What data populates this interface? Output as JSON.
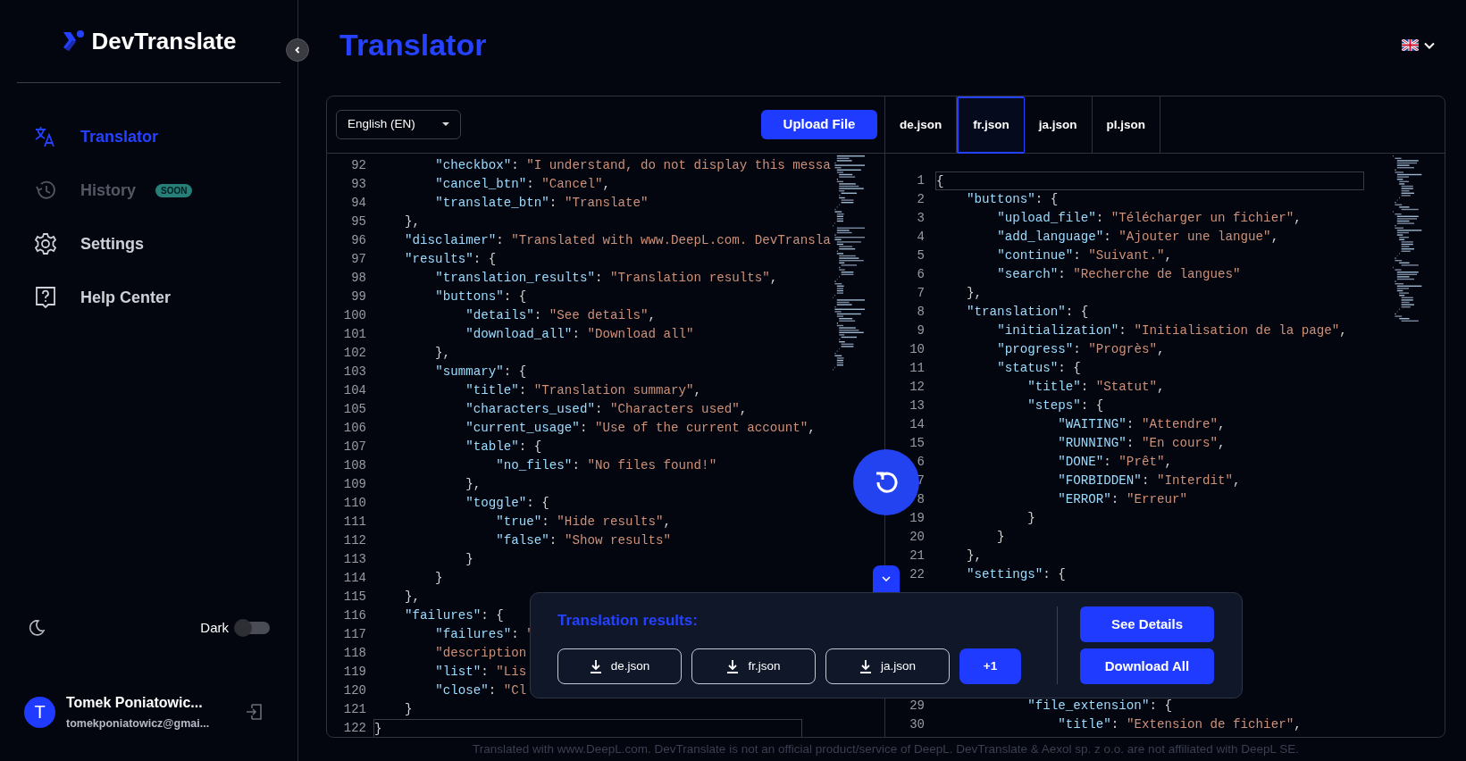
{
  "sidebar": {
    "brand": "DevTranslate",
    "nav": [
      {
        "label": "Translator",
        "selected": true,
        "disabled": false
      },
      {
        "label": "History",
        "selected": false,
        "disabled": true,
        "badge": "SOON"
      },
      {
        "label": "Settings",
        "selected": false,
        "disabled": false
      },
      {
        "label": "Help Center",
        "selected": false,
        "disabled": false
      }
    ],
    "theme": {
      "label": "Dark",
      "on": false
    },
    "user": {
      "initial": "T",
      "name": "Tomek Poniatowic...",
      "email": "tomekponiatowicz@gmai..."
    }
  },
  "page_title": "Translator",
  "source": {
    "language": "English (EN)",
    "upload_button": "Upload File",
    "lines": [
      {
        "kind": "code",
        "n": "92",
        "text": "        \"checkbox\": \"I understand, do not display this messa",
        "current": false
      },
      {
        "kind": "code",
        "n": "93",
        "text": "        \"cancel_btn\": \"Cancel\",",
        "current": false
      },
      {
        "kind": "code",
        "n": "94",
        "text": "        \"translate_btn\": \"Translate\"",
        "current": false
      },
      {
        "kind": "code",
        "n": "95",
        "text": "    },",
        "current": false
      },
      {
        "kind": "code",
        "n": "96",
        "text": "    \"disclaimer\": \"Translated with www.DeepL.com. DevTransla",
        "current": false
      },
      {
        "kind": "code",
        "n": "97",
        "text": "    \"results\": {",
        "current": false
      },
      {
        "kind": "code",
        "n": "98",
        "text": "        \"translation_results\": \"Translation results\",",
        "current": false
      },
      {
        "kind": "code",
        "n": "99",
        "text": "        \"buttons\": {",
        "current": false
      },
      {
        "kind": "code",
        "n": "100",
        "text": "            \"details\": \"See details\",",
        "current": false
      },
      {
        "kind": "code",
        "n": "101",
        "text": "            \"download_all\": \"Download all\"",
        "current": false
      },
      {
        "kind": "code",
        "n": "102",
        "text": "        },",
        "current": false
      },
      {
        "kind": "code",
        "n": "103",
        "text": "        \"summary\": {",
        "current": false
      },
      {
        "kind": "code",
        "n": "104",
        "text": "            \"title\": \"Translation summary\",",
        "current": false
      },
      {
        "kind": "code",
        "n": "105",
        "text": "            \"characters_used\": \"Characters used\",",
        "current": false
      },
      {
        "kind": "code",
        "n": "106",
        "text": "            \"current_usage\": \"Use of the current account\",",
        "current": false
      },
      {
        "kind": "code",
        "n": "107",
        "text": "            \"table\": {",
        "current": false
      },
      {
        "kind": "code",
        "n": "108",
        "text": "                \"no_files\": \"No files found!\"",
        "current": false
      },
      {
        "kind": "code",
        "n": "109",
        "text": "            },",
        "current": false
      },
      {
        "kind": "code",
        "n": "110",
        "text": "            \"toggle\": {",
        "current": false
      },
      {
        "kind": "code",
        "n": "111",
        "text": "                \"true\": \"Hide results\",",
        "current": false
      },
      {
        "kind": "code",
        "n": "112",
        "text": "                \"false\": \"Show results\"",
        "current": false
      },
      {
        "kind": "code",
        "n": "113",
        "text": "            }",
        "current": false
      },
      {
        "kind": "code",
        "n": "114",
        "text": "        }",
        "current": false
      },
      {
        "kind": "code",
        "n": "115",
        "text": "    },",
        "current": false
      },
      {
        "kind": "code",
        "n": "116",
        "text": "    \"failures\": {",
        "current": false
      },
      {
        "kind": "code",
        "n": "117",
        "text": "        \"failures\": \"",
        "current": false
      },
      {
        "kind": "code",
        "n": "118",
        "text": "        \"description",
        "current": false
      },
      {
        "kind": "code",
        "n": "119",
        "text": "        \"list\": \"Lis",
        "current": false
      },
      {
        "kind": "code",
        "n": "120",
        "text": "        \"close\": \"Cl",
        "current": false
      },
      {
        "kind": "code",
        "n": "121",
        "text": "    }",
        "current": false
      },
      {
        "kind": "code",
        "n": "122",
        "text": "}",
        "current": true
      }
    ]
  },
  "target": {
    "tabs": [
      {
        "label": "de.json",
        "selected": false
      },
      {
        "label": "fr.json",
        "selected": true
      },
      {
        "label": "ja.json",
        "selected": false
      },
      {
        "label": "pl.json",
        "selected": false
      }
    ],
    "lines": [
      {
        "kind": "code",
        "n": "1",
        "text": "{",
        "current": true
      },
      {
        "kind": "code",
        "n": "2",
        "text": "    \"buttons\": {",
        "current": false
      },
      {
        "kind": "code",
        "n": "3",
        "text": "        \"upload_file\": \"Télécharger un fichier\",",
        "current": false
      },
      {
        "kind": "code",
        "n": "4",
        "text": "        \"add_language\": \"Ajouter une langue\",",
        "current": false
      },
      {
        "kind": "code",
        "n": "5",
        "text": "        \"continue\": \"Suivant.\",",
        "current": false
      },
      {
        "kind": "code",
        "n": "6",
        "text": "        \"search\": \"Recherche de langues\"",
        "current": false
      },
      {
        "kind": "code",
        "n": "7",
        "text": "    },",
        "current": false
      },
      {
        "kind": "code",
        "n": "8",
        "text": "    \"translation\": {",
        "current": false
      },
      {
        "kind": "code",
        "n": "9",
        "text": "        \"initialization\": \"Initialisation de la page\",",
        "current": false
      },
      {
        "kind": "code",
        "n": "10",
        "text": "        \"progress\": \"Progrès\",",
        "current": false
      },
      {
        "kind": "code",
        "n": "11",
        "text": "        \"status\": {",
        "current": false
      },
      {
        "kind": "code",
        "n": "12",
        "text": "            \"title\": \"Statut\",",
        "current": false
      },
      {
        "kind": "code",
        "n": "13",
        "text": "            \"steps\": {",
        "current": false
      },
      {
        "kind": "code",
        "n": "14",
        "text": "                \"WAITING\": \"Attendre\",",
        "current": false
      },
      {
        "kind": "code",
        "n": "15",
        "text": "                \"RUNNING\": \"En cours\",",
        "current": false
      },
      {
        "kind": "code",
        "n": "6",
        "text": "                \"DONE\": \"Prêt\",",
        "current": false
      },
      {
        "kind": "code",
        "n": "7",
        "text": "                \"FORBIDDEN\": \"Interdit\",",
        "current": false
      },
      {
        "kind": "code",
        "n": "8",
        "text": "                \"ERROR\": \"Erreur\"",
        "current": false
      },
      {
        "kind": "code",
        "n": "19",
        "text": "            }",
        "current": false
      },
      {
        "kind": "code",
        "n": "20",
        "text": "        }",
        "current": false
      },
      {
        "kind": "code",
        "n": "21",
        "text": "    },",
        "current": false
      },
      {
        "kind": "code",
        "n": "22",
        "text": "    \"settings\": {",
        "current": false
      },
      {
        "kind": "covered"
      },
      {
        "kind": "covered"
      },
      {
        "kind": "covered"
      },
      {
        "kind": "covered"
      },
      {
        "kind": "covered"
      },
      {
        "kind": "covered"
      },
      {
        "kind": "code",
        "n": "29",
        "text": "            \"file_extension\": {",
        "current": false
      },
      {
        "kind": "code",
        "n": "30",
        "text": "                \"title\": \"Extension de fichier\",",
        "current": false
      }
    ]
  },
  "results_popup": {
    "title": "Translation results:",
    "files": [
      "de.json",
      "fr.json",
      "ja.json"
    ],
    "more": "+1",
    "see_details": "See Details",
    "download_all": "Download All"
  },
  "footer": "Translated with www.DeepL.com. DevTranslate is not an official product/service of DeepL. DevTranslate & Aexol sp. z o.o. are not affiliated with DeepL SE."
}
